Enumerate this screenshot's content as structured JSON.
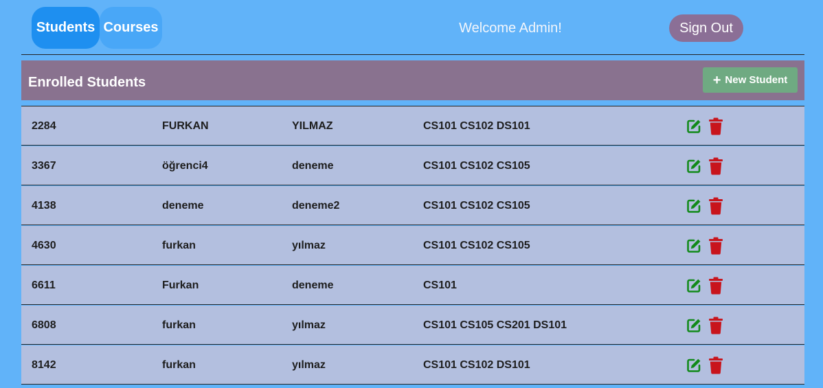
{
  "nav": {
    "students_label": "Students",
    "courses_label": "Courses",
    "welcome_text": "Welcome Admin!",
    "signout_label": "Sign Out"
  },
  "panel": {
    "title": "Enrolled Students",
    "new_student_label": "New Student",
    "new_student_icon": "plus-icon"
  },
  "students": [
    {
      "id": "2284",
      "first_name": "FURKAN",
      "last_name": "YILMAZ",
      "courses": "CS101 CS102 DS101"
    },
    {
      "id": "3367",
      "first_name": "öğrenci4",
      "last_name": "deneme",
      "courses": "CS101 CS102 CS105"
    },
    {
      "id": "4138",
      "first_name": "deneme",
      "last_name": "deneme2",
      "courses": "CS101 CS102 CS105"
    },
    {
      "id": "4630",
      "first_name": "furkan",
      "last_name": "yılmaz",
      "courses": "CS101 CS102 CS105"
    },
    {
      "id": "6611",
      "first_name": "Furkan",
      "last_name": "deneme",
      "courses": "CS101"
    },
    {
      "id": "6808",
      "first_name": "furkan",
      "last_name": "yılmaz",
      "courses": "CS101 CS105 CS201 DS101"
    },
    {
      "id": "8142",
      "first_name": "furkan",
      "last_name": "yılmaz",
      "courses": "CS101 CS102 DS101"
    }
  ],
  "row_actions": [
    "edit-icon",
    "trash-icon"
  ],
  "colors": {
    "background": "#61b3f9",
    "active_tab": "#1e8ff0",
    "inactive_tab": "#49a7f7",
    "signout": "#8b6f96",
    "header": "#89728f",
    "new_button": "#6faa82",
    "row": "#b3bfdf",
    "edit": "#128a1a",
    "delete": "#c8141c"
  }
}
